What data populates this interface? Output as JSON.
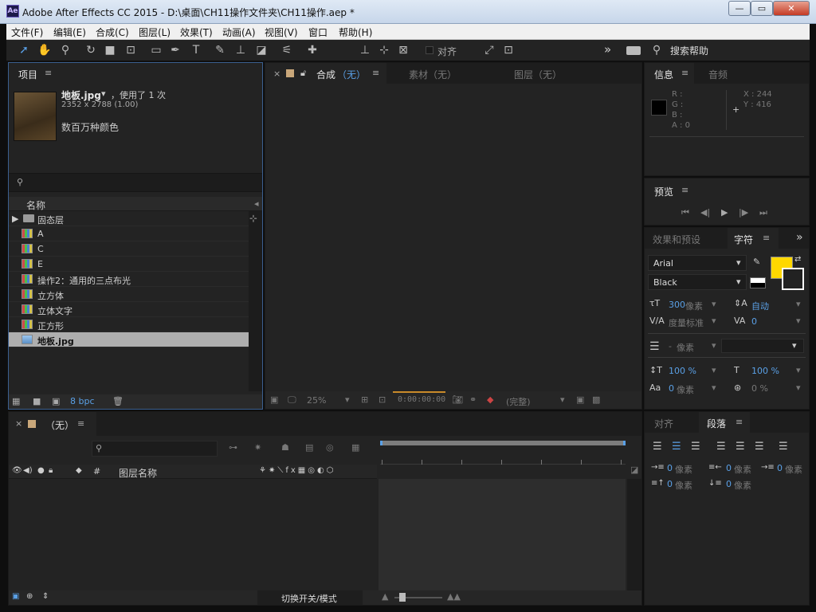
{
  "window": {
    "app_icon": "Ae",
    "title": "Adobe After Effects CC 2015 - D:\\桌面\\CH11操作文件夹\\CH11操作.aep *"
  },
  "menu": [
    "文件(F)",
    "编辑(E)",
    "合成(C)",
    "图层(L)",
    "效果(T)",
    "动画(A)",
    "视图(V)",
    "窗口",
    "帮助(H)"
  ],
  "toolbar": {
    "align_label": "对齐",
    "more": "»",
    "search_help": "搜索帮助"
  },
  "project": {
    "tab": "项目",
    "item_name": "地板.jpg",
    "item_usage": "，使用了 1 次",
    "item_dims": "2352 x 2788 (1.00)",
    "item_colors": "数百万种颜色",
    "column_name": "名称",
    "items": [
      {
        "name": "固态层",
        "type": "folder"
      },
      {
        "name": "A",
        "type": "comp"
      },
      {
        "name": "C",
        "type": "comp"
      },
      {
        "name": "E",
        "type": "comp"
      },
      {
        "name": "操作2：通用的三点布光",
        "type": "comp"
      },
      {
        "name": "立方体",
        "type": "comp"
      },
      {
        "name": "立体文字",
        "type": "comp"
      },
      {
        "name": "正方形",
        "type": "comp"
      },
      {
        "name": "地板.jpg",
        "type": "image",
        "selected": true
      }
    ],
    "bpc": "8 bpc"
  },
  "comp_viewer": {
    "tab_comp": "合成",
    "tab_comp_value": "（无）",
    "tab_footage": "素材（无）",
    "tab_layer": "图层（无）",
    "zoom": "25%",
    "timecode": "0:00:00:00",
    "resolution": "(完整)"
  },
  "info": {
    "tab_info": "信息",
    "tab_audio": "音频",
    "r": "R :",
    "g": "G :",
    "b": "B :",
    "a": "A : 0",
    "x": "X : 244",
    "y": "Y : 416"
  },
  "preview": {
    "tab": "预览"
  },
  "character": {
    "tab_effects": "效果和预设",
    "tab_char": "字符",
    "font": "Arial",
    "style": "Black",
    "font_size": "300",
    "font_size_unit": "像素",
    "leading": "自动",
    "kerning": "度量标准",
    "tracking": "0",
    "stroke_dash": "-",
    "stroke_unit": "像素",
    "vscale": "100 %",
    "hscale": "100 %",
    "baseline": "0",
    "baseline_unit": "像素",
    "tsume": "0 %",
    "fill_color": "#ffd800"
  },
  "paragraph": {
    "tab_align": "对齐",
    "tab_para": "段落",
    "indent_left": "0",
    "indent_right": "0",
    "indent_first": "0",
    "space_before": "0",
    "space_after": "0",
    "unit": "像素"
  },
  "timeline": {
    "tab": "（无）",
    "col_layer_name": "图层名称",
    "col_num": "#",
    "toggle_label": "切换开关/模式"
  }
}
